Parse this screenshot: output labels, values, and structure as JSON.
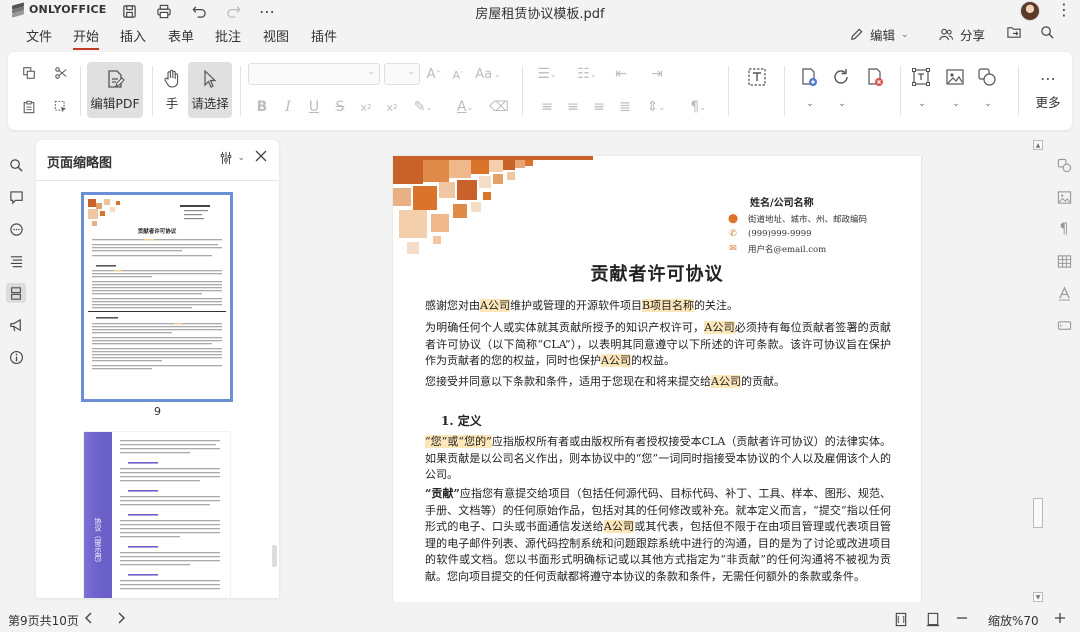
{
  "app": {
    "logo_text": "ONLYOFFICE",
    "doc_title": "房屋租赁协议模板.pdf"
  },
  "menu": {
    "items": [
      "文件",
      "开始",
      "插入",
      "表单",
      "批注",
      "视图",
      "插件"
    ],
    "active": "开始",
    "edit_label": "编辑",
    "share_label": "分享"
  },
  "toolbar": {
    "edit_pdf_label": "编辑PDF",
    "hand_label": "手",
    "select_label": "请选择",
    "more_label": "更多"
  },
  "thumbnails": {
    "title": "页面缩略图",
    "page_label_1": "9",
    "thumb1_title": "贡献者许可协议",
    "thumb2_vertical_text": "协议（提示用）"
  },
  "document": {
    "contact": {
      "name": "姓名/公司名称",
      "address": "街道地址、城市、州、邮政编码",
      "phone": "(999)999-9999",
      "email": "用户名@email.com"
    },
    "title": "贡献者许可协议",
    "p1_a": "感谢您对由",
    "p1_hl1": "A公司",
    "p1_b": "维护或管理的开源软件项目",
    "p1_hl2": "B项目名称",
    "p1_c": "的关注。",
    "p2_a": "为明确任何个人或实体就其贡献所授予的知识产权许可，",
    "p2_hl1": "A公司",
    "p2_b": "必须持有每位贡献者签署的贡献者许可协议（以下简称“CLA”），以表明其同意遵守以下所述的许可条款。该许可协议旨在保护作为贡献者的您的权益，同时也保护",
    "p2_hl2": "A公司",
    "p2_c": "的权益。",
    "p3_a": "您接受并同意以下条款和条件，适用于您现在和将来提交给",
    "p3_hl": "A公司",
    "p3_b": "的贡献。",
    "section1": "1.  定义",
    "p4_hl": "“您”或“您的”",
    "p4_b": "应指版权所有者或由版权所有者授权接受本CLA（贡献者许可协议）的法律实体。如果贡献是以公司名义作出，则本协议中的“您”一词同时指接受本协议的个人以及雇佣该个人的公司。",
    "p5_bold": "“贡献”",
    "p5_a": "应指您有意提交给项目（包括任何源代码、目标代码、补丁、工具、样本、图形、规范、手册、文档等）的任何原始作品，包括对其的任何修改或补充。就本定义而言，“提交”指以任何形式的电子、口头或书面通信发送给",
    "p5_hl": "A公司",
    "p5_b": "或其代表，包括但不限于在由项目管理或代表项目管理的电子邮件列表、源代码控制系统和问题跟踪系统中进行的沟通，目的是为了讨论或改进项目的软件或文档。您以书面形式明确标记或以其他方式指定为“非贡献”的任何沟通将不被视为贡献。您向项目提交的任何贡献都将遵守本协议的条款和条件，无需任何额外的条款或条件。"
  },
  "status": {
    "page_info": "第9页共10页",
    "zoom": "缩放%70"
  },
  "colors": {
    "accent": "#c0392b",
    "highlight": "#fde7b8",
    "orange": "#d9742a",
    "thumb_border": "#6a8fd4"
  }
}
